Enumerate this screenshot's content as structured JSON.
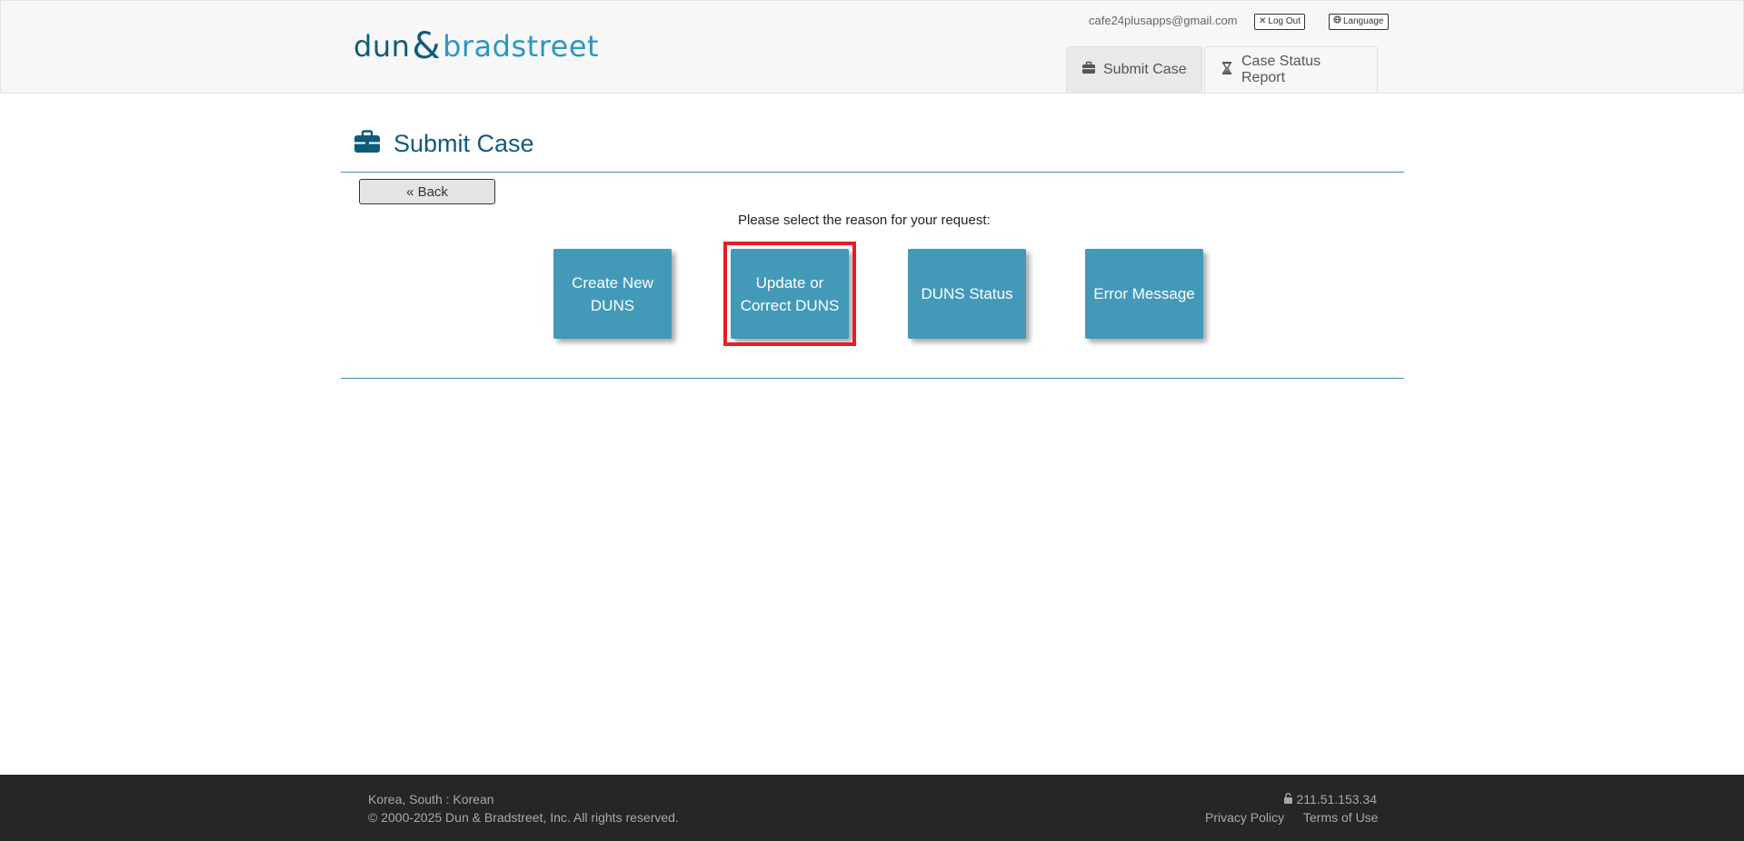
{
  "header": {
    "logo": {
      "part1": "dun",
      "amp": "&",
      "part2": "bradstreet"
    },
    "user_email": "cafe24plusapps@gmail.com",
    "logout_label": "Log Out",
    "language_label": "Language",
    "tabs": [
      {
        "label": "Submit Case",
        "icon": "briefcase-icon",
        "active": true
      },
      {
        "label": "Case Status Report",
        "icon": "hourglass-icon",
        "active": false
      }
    ]
  },
  "main": {
    "title": "Submit Case",
    "title_icon": "briefcase-icon",
    "back_label": "« Back",
    "prompt": "Please select the reason for your request:",
    "reasons": [
      {
        "label": "Create New DUNS"
      },
      {
        "label": "Update or Correct DUNS",
        "highlighted": true
      },
      {
        "label": "DUNS Status"
      },
      {
        "label": "Error Message"
      }
    ]
  },
  "footer": {
    "region": "Korea, South : Korean",
    "copyright": "© 2000-2025 Dun & Bradstreet, Inc. All rights reserved.",
    "ip": "211.51.153.34",
    "privacy_label": "Privacy Policy",
    "terms_label": "Terms of Use"
  },
  "colors": {
    "brand_dark": "#0f5b7a",
    "brand_light": "#2d96c0",
    "button_bg": "#4399b8",
    "highlight": "#e31e24",
    "footer_bg": "#262626"
  }
}
